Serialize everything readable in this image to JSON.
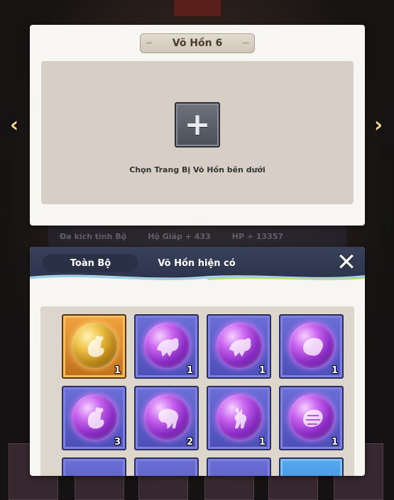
{
  "slot_panel": {
    "title": "Võ Hồn 6",
    "hint": "Chọn Trang Bị Võ Hồn bên dưới"
  },
  "background": {
    "stat_text_1": "Đa kích tính Bộ",
    "stat_text_2": "Hộ Giáp + 433",
    "stat_text_3": "HP + 13357"
  },
  "inventory": {
    "tab_all": "Toàn Bộ",
    "tab_current": "Võ Hồn hiện có",
    "items": [
      {
        "icon": "rooster-icon",
        "rarity": "gold",
        "count": "1"
      },
      {
        "icon": "panther-icon",
        "rarity": "purple",
        "count": "1"
      },
      {
        "icon": "panther-icon",
        "rarity": "purple",
        "count": "1"
      },
      {
        "icon": "tiger-icon",
        "rarity": "purple",
        "count": "1"
      },
      {
        "icon": "rooster-icon",
        "rarity": "purple",
        "count": "3"
      },
      {
        "icon": "elephant-icon",
        "rarity": "purple",
        "count": "2"
      },
      {
        "icon": "deer-icon",
        "rarity": "purple",
        "count": "1"
      },
      {
        "icon": "pangolin-icon",
        "rarity": "purple",
        "count": "1"
      }
    ]
  },
  "colors": {
    "header": "#39415a",
    "orb_purple": "#c864f0",
    "orb_gold": "#f0c54a"
  }
}
